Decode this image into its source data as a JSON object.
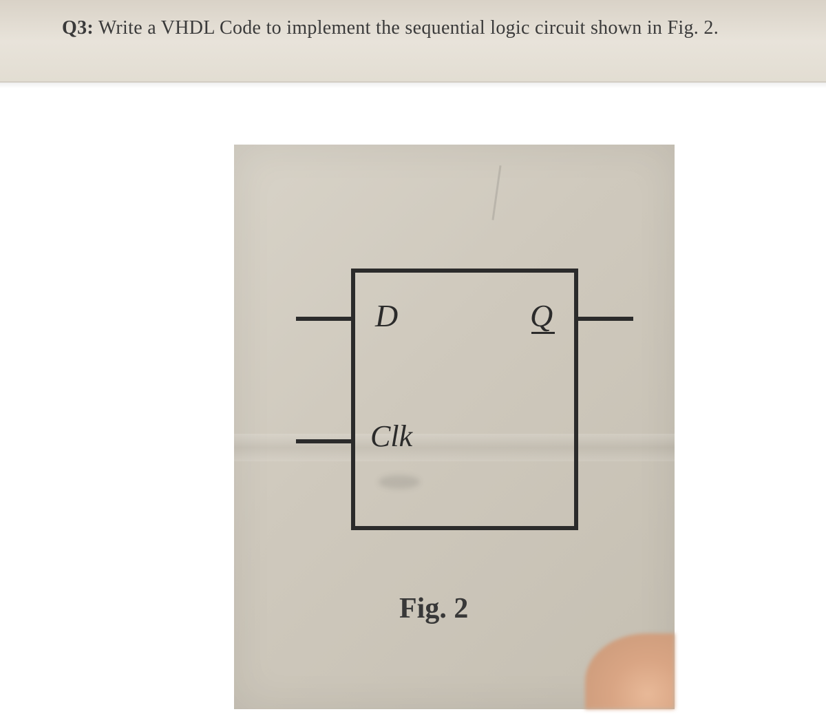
{
  "question": {
    "prefix": "Q3:",
    "text": "Write a VHDL Code to implement the sequential logic circuit shown in Fig. 2."
  },
  "circuit": {
    "ports": {
      "d": "D",
      "clk": "Clk",
      "q": "Q"
    },
    "caption": "Fig. 2"
  }
}
